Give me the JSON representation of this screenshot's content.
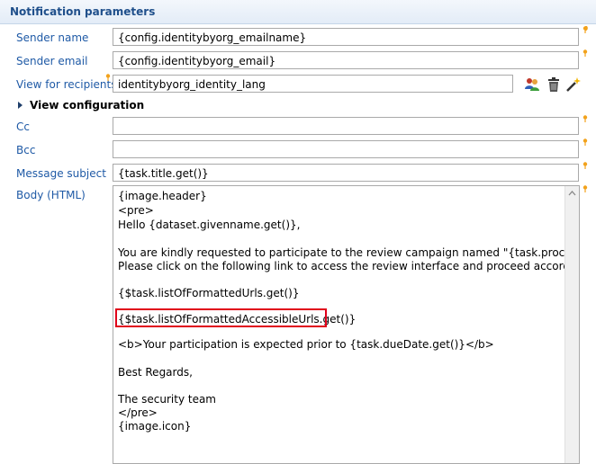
{
  "section": {
    "title": "Notification parameters"
  },
  "fields": {
    "sender_name": {
      "label": "Sender name",
      "value": "{config.identitybyorg_emailname}"
    },
    "sender_email": {
      "label": "Sender email",
      "value": "{config.identitybyorg_email}"
    },
    "view_recipients": {
      "label": "View for recipients",
      "value": "identitybyorg_identity_lang"
    },
    "cc": {
      "label": "Cc",
      "value": ""
    },
    "bcc": {
      "label": "Bcc",
      "value": ""
    },
    "subject": {
      "label": "Message subject",
      "value": "{task.title.get()}"
    },
    "body": {
      "label": "Body (HTML)"
    }
  },
  "view_configuration": {
    "label": "View configuration"
  },
  "toolbar_icons": [
    "users-icon",
    "trash-icon",
    "magic-wand-icon"
  ],
  "body_lines": [
    "{image.header}",
    "<pre>",
    "Hello {dataset.givenname.get()},",
    "",
    "You are kindly requested to participate to the review campaign named \"{task.processTitle.get()",
    "Please click on the following link to access the review interface and proceed accordingly.",
    "",
    "{$task.listOfFormattedUrls.get()}",
    "",
    "{$task.listOfFormattedAccessibleUrls.get()}",
    "",
    "<b>Your participation is expected prior to {task.dueDate.get()}</b>",
    "",
    "Best Regards,",
    "",
    "The security team",
    "</pre>",
    "{image.icon}"
  ],
  "colors": {
    "label": "#1f5aa6",
    "header_text": "#1f4f8b",
    "highlight": "#e0001a",
    "hint": "#f2a21c"
  }
}
